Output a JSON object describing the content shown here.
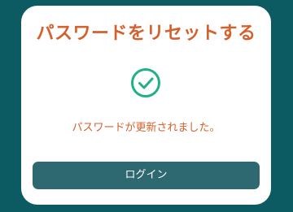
{
  "card": {
    "title": "パスワードをリセットする",
    "status_icon": "check-circle-icon",
    "message": "パスワードが更新されました。",
    "login_button_label": "ログイン"
  },
  "colors": {
    "background": "#0c5a62",
    "accent": "#d6602c",
    "success": "#1fb08a",
    "button": "#2e6870"
  }
}
